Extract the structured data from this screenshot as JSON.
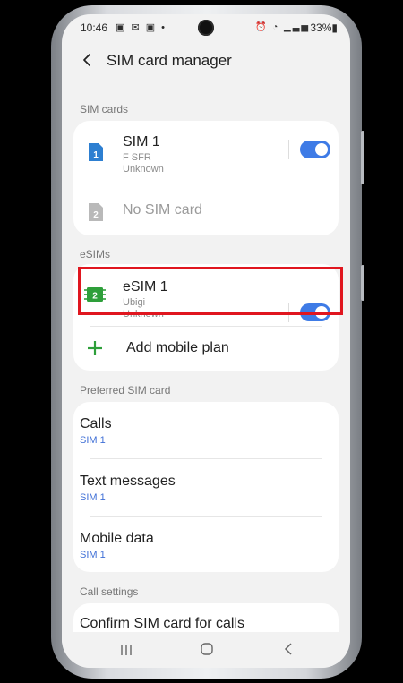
{
  "status_bar": {
    "time": "10:46",
    "notification_icons": "▣ ✉ ▣ •",
    "system_icons": "⏰ ◔ ▁▃▅",
    "battery": "33%▮"
  },
  "header": {
    "title": "SIM card manager",
    "back_icon": "chevron-left-icon"
  },
  "sections": {
    "sim_cards": "SIM cards",
    "esims": "eSIMs",
    "preferred": "Preferred SIM card",
    "call_settings": "Call settings"
  },
  "sim_cards": {
    "sim1": {
      "title": "SIM 1",
      "badge": "1",
      "line1": "F SFR",
      "line2": "Unknown",
      "enabled": true
    },
    "sim2": {
      "title": "No SIM card",
      "badge": "2"
    }
  },
  "esims": {
    "esim1": {
      "title": "eSIM 1",
      "badge": "2",
      "line1": "Ubigi",
      "line2": "Unknown",
      "enabled": true
    },
    "add": {
      "label": "Add mobile plan",
      "icon": "plus-icon"
    }
  },
  "preferred": [
    {
      "title": "Calls",
      "value": "SIM 1"
    },
    {
      "title": "Text messages",
      "value": "SIM 1"
    },
    {
      "title": "Mobile data",
      "value": "SIM 1"
    }
  ],
  "call_settings": {
    "confirm": "Confirm SIM card for calls"
  },
  "navbar": {
    "recents": "recents-icon",
    "home": "home-icon",
    "back": "back-icon"
  },
  "colors": {
    "accent": "#3e7be6",
    "sim1_badge": "#2d7fd1",
    "esim_badge": "#2e9f3a",
    "highlight": "#e0161f",
    "add_plus": "#2e9f3a"
  }
}
